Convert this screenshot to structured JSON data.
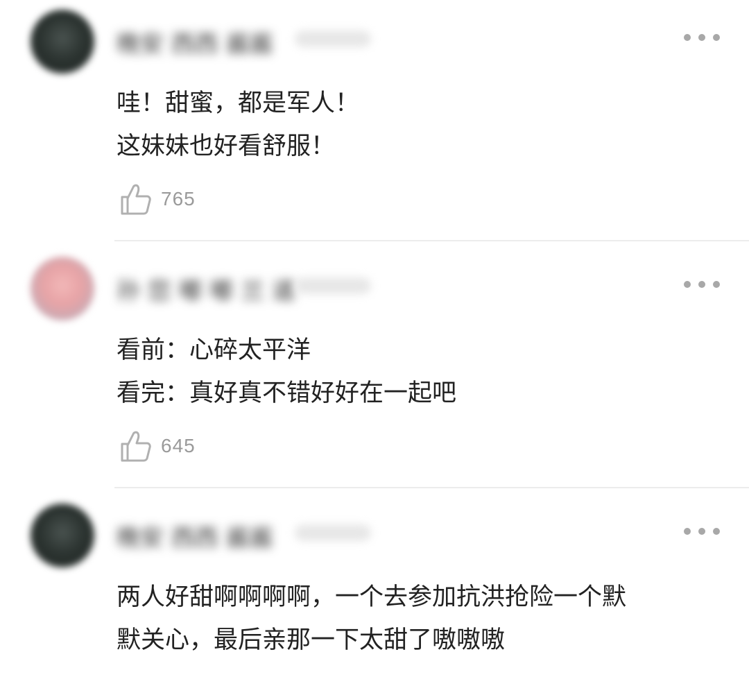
{
  "comments": [
    {
      "avatar": "dark",
      "username": "晚安 西西 酱酱",
      "text_lines": [
        "哇！甜蜜，都是军人！",
        "这妹妹也好看舒服！"
      ],
      "likes": "765"
    },
    {
      "avatar": "light",
      "username": "孙 您 嘟 嘟 兰 道",
      "text_lines": [
        "看前：心碎太平洋",
        "看完：真好真不错好好在一起吧"
      ],
      "likes": "645"
    },
    {
      "avatar": "dark",
      "username": "晚安 西西 酱酱",
      "text_lines": [
        "两人好甜啊啊啊啊，一个去参加抗洪抢险一个默",
        "默关心，最后亲那一下太甜了嗷嗷嗷"
      ],
      "likes": ""
    }
  ],
  "icons": {
    "like": "thumbs-up-icon",
    "more": "more-horizontal-icon"
  },
  "colors": {
    "divider": "#ececec",
    "meta_text": "#9a9a9a",
    "body_text": "#222222"
  }
}
